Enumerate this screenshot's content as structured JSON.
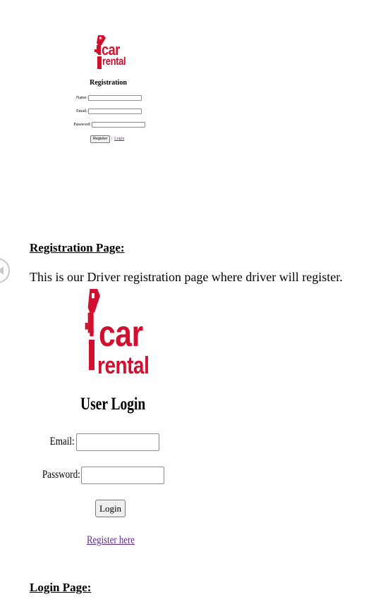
{
  "brand": {
    "logo_word_1": "car",
    "logo_word_2": "rental",
    "color": "#d0102f"
  },
  "registration_form": {
    "title": "Registration",
    "name_label": "Name:",
    "email_label": "Email:",
    "password_label": "Password:",
    "register_button": "Register",
    "separator": "|",
    "login_link": "Login"
  },
  "registration_section": {
    "heading": "Registration Page:",
    "description": "This is our Driver registration page where driver will register."
  },
  "login_form": {
    "title": "User Login",
    "email_label": "Email:",
    "password_label": "Password:",
    "login_button": "Login",
    "register_link": "Register here"
  },
  "login_section": {
    "heading": "Login Page:"
  },
  "icons": {
    "nav": "previous-page-icon",
    "logo": "car-key-icon"
  }
}
